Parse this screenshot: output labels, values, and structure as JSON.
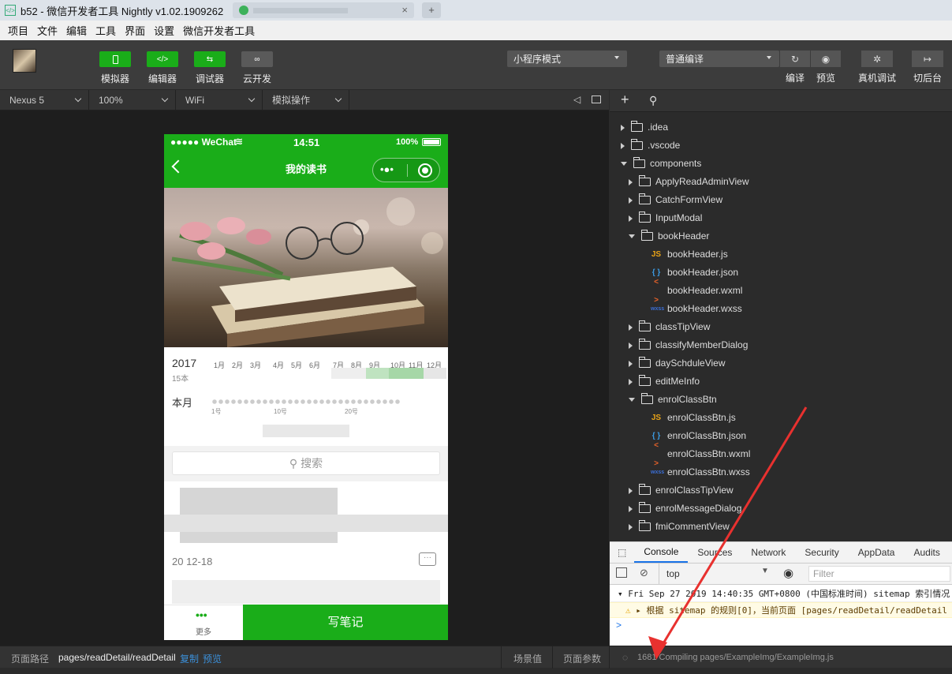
{
  "window": {
    "title": "b52 - 微信开发者工具 Nightly v1.02.1909262",
    "app_icon": "</>"
  },
  "menu": [
    "项目",
    "文件",
    "编辑",
    "工具",
    "界面",
    "设置",
    "微信开发者工具"
  ],
  "toolbar": {
    "buttons": [
      {
        "label": "模拟器",
        "icon": "phone-icon"
      },
      {
        "label": "编辑器",
        "icon": "code-icon"
      },
      {
        "label": "调试器",
        "icon": "debug-icon"
      },
      {
        "label": "云开发",
        "icon": "cloud-icon"
      }
    ],
    "mode_select": "小程序模式",
    "compile_select": "普通编译",
    "actions": [
      {
        "label": "编译",
        "icon": "refresh-icon"
      },
      {
        "label": "预览",
        "icon": "eye-icon"
      },
      {
        "label": "真机调试",
        "icon": "bug-icon"
      },
      {
        "label": "切后台",
        "icon": "switch-icon"
      }
    ]
  },
  "device_bar": {
    "device": "Nexus 5",
    "zoom": "100%",
    "network": "WiFi",
    "ops": "模拟操作"
  },
  "phone": {
    "status": {
      "carrier": "●●●●● WeChat",
      "time": "14:51",
      "battery": "100%"
    },
    "nav_title": "我的读书",
    "calendar": {
      "year": "2017",
      "count": "15本",
      "months": [
        "1月",
        "2月",
        "3月",
        "4月",
        "5月",
        "6月",
        "7月",
        "8月",
        "9月",
        "10月",
        "11月",
        "12月"
      ],
      "this_month": "本月",
      "days": [
        "1号",
        "10号",
        "20号"
      ]
    },
    "search_placeholder": "搜索",
    "date_partial": "20   12-18",
    "more_label": "更多",
    "write_note": "写笔记"
  },
  "file_tree": [
    {
      "name": ".idea",
      "type": "folder",
      "depth": 0,
      "open": false
    },
    {
      "name": ".vscode",
      "type": "folder",
      "depth": 0,
      "open": false
    },
    {
      "name": "components",
      "type": "folder",
      "depth": 0,
      "open": true
    },
    {
      "name": "ApplyReadAdminView",
      "type": "folder",
      "depth": 1,
      "open": false
    },
    {
      "name": "CatchFormView",
      "type": "folder",
      "depth": 1,
      "open": false
    },
    {
      "name": "InputModal",
      "type": "folder",
      "depth": 1,
      "open": false
    },
    {
      "name": "bookHeader",
      "type": "folder",
      "depth": 1,
      "open": true
    },
    {
      "name": "bookHeader.js",
      "type": "js",
      "depth": 2
    },
    {
      "name": "bookHeader.json",
      "type": "json",
      "depth": 2
    },
    {
      "name": "bookHeader.wxml",
      "type": "wxml",
      "depth": 2
    },
    {
      "name": "bookHeader.wxss",
      "type": "wxss",
      "depth": 2
    },
    {
      "name": "classTipView",
      "type": "folder",
      "depth": 1,
      "open": false
    },
    {
      "name": "classifyMemberDialog",
      "type": "folder",
      "depth": 1,
      "open": false
    },
    {
      "name": "daySchduleView",
      "type": "folder",
      "depth": 1,
      "open": false
    },
    {
      "name": "editMeInfo",
      "type": "folder",
      "depth": 1,
      "open": false
    },
    {
      "name": "enrolClassBtn",
      "type": "folder",
      "depth": 1,
      "open": true
    },
    {
      "name": "enrolClassBtn.js",
      "type": "js",
      "depth": 2
    },
    {
      "name": "enrolClassBtn.json",
      "type": "json",
      "depth": 2
    },
    {
      "name": "enrolClassBtn.wxml",
      "type": "wxml",
      "depth": 2
    },
    {
      "name": "enrolClassBtn.wxss",
      "type": "wxss",
      "depth": 2
    },
    {
      "name": "enrolClassTipView",
      "type": "folder",
      "depth": 1,
      "open": false
    },
    {
      "name": "enrolMessageDialog",
      "type": "folder",
      "depth": 1,
      "open": false
    },
    {
      "name": "fmiCommentView",
      "type": "folder",
      "depth": 1,
      "open": false
    }
  ],
  "file_icons": {
    "js": "JS",
    "json": "{ }",
    "wxml": "< >",
    "wxss": "wxss"
  },
  "console": {
    "tabs": [
      "Console",
      "Sources",
      "Network",
      "Security",
      "AppData",
      "Audits"
    ],
    "context": "top",
    "filter_placeholder": "Filter",
    "log1": "Fri Sep 27 2019 14:40:35 GMT+0800 (中国标准时间) sitemap 索引情况",
    "log2": "根据 sitemap 的规则[0]，当前页面 [pages/readDetail/readDetail",
    "prompt": ">"
  },
  "footer": {
    "path_label": "页面路径",
    "path": "pages/readDetail/readDetail",
    "copy": "复制",
    "preview": "预览",
    "scene": "场景值",
    "params": "页面参数",
    "compiling": "1681 Compiling pages/ExampleImg/ExampleImg.js"
  },
  "colors": {
    "accent": "#1aad19",
    "annotation_arrow": "#e8312f"
  }
}
